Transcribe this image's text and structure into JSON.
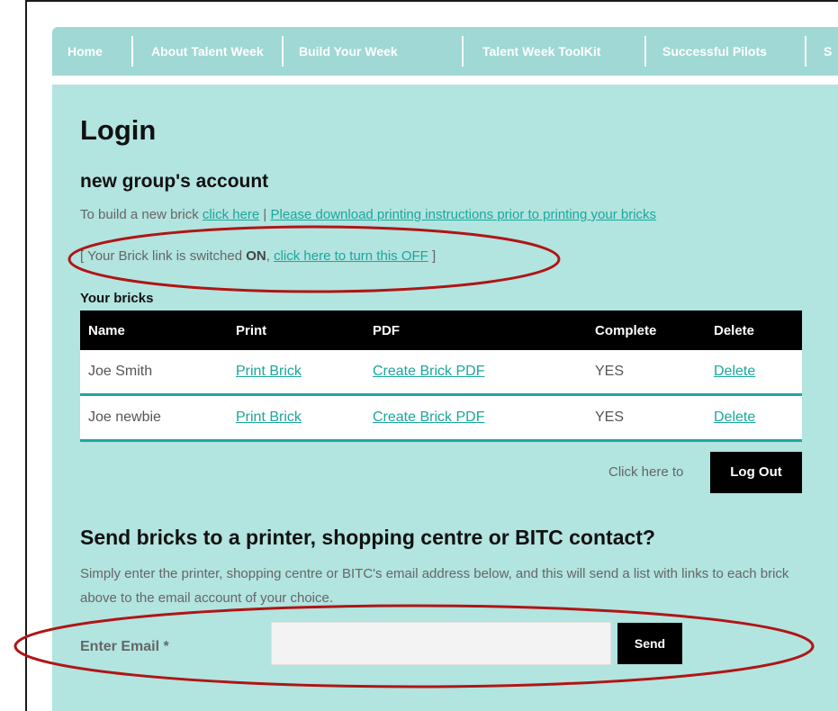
{
  "nav": {
    "items": [
      "Home",
      "About Talent Week",
      "Build Your Week",
      "Talent Week ToolKit",
      "Successful Pilots",
      "S"
    ]
  },
  "page": {
    "title": "Login",
    "subtitle": "new group's account",
    "intro": {
      "prefix": "To build a new brick ",
      "click_here": "click here",
      "separator": " | ",
      "download_link": "Please download printing instructions prior to printing your bricks"
    },
    "status": {
      "open": "[ Your Brick link is switched ",
      "state": "ON",
      "comma": ", ",
      "toggle_link": "click here to turn this OFF",
      "close": " ]"
    }
  },
  "bricks": {
    "label": "Your bricks",
    "headers": [
      "Name",
      "Print",
      "PDF",
      "Complete",
      "Delete"
    ],
    "rows": [
      {
        "name": "Joe Smith",
        "print": "Print Brick",
        "pdf": "Create Brick PDF",
        "complete": "YES",
        "delete": "Delete"
      },
      {
        "name": "Joe newbie",
        "print": "Print Brick",
        "pdf": "Create Brick PDF",
        "complete": "YES",
        "delete": "Delete"
      }
    ]
  },
  "logout": {
    "prompt": "Click here to",
    "button": "Log Out"
  },
  "send": {
    "heading": "Send bricks to a printer, shopping centre or BITC contact?",
    "description": "Simply enter the printer, shopping centre or BITC's email address below, and this will send a list with links to each brick above to the email account of your choice.",
    "email_label": "Enter Email *",
    "email_value": "",
    "button": "Send"
  },
  "colors": {
    "nav_bg": "#9fd8d4",
    "content_bg": "#b2e4e0",
    "link": "#1aa79c",
    "annotation": "#b01515"
  }
}
